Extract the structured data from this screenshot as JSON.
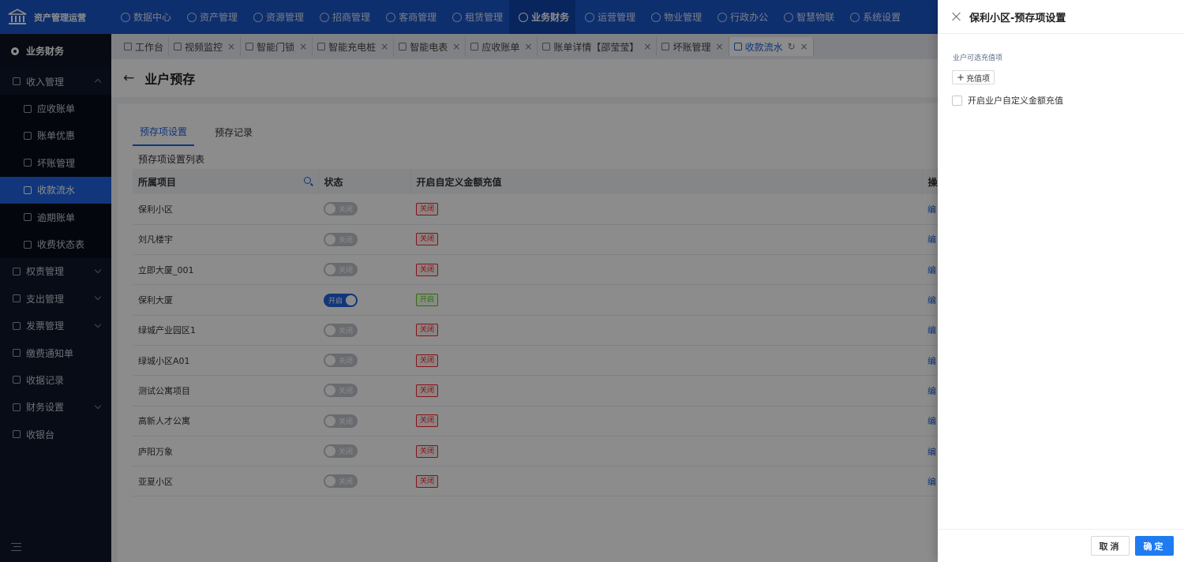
{
  "app": {
    "name": "资产管理运营"
  },
  "topnav": [
    {
      "label": "数据中心",
      "icon": "dashboard-icon"
    },
    {
      "label": "资产管理",
      "icon": "cube-icon"
    },
    {
      "label": "资源管理",
      "icon": "building-icon"
    },
    {
      "label": "招商管理",
      "icon": "tag-icon"
    },
    {
      "label": "客商管理",
      "icon": "people-icon"
    },
    {
      "label": "租赁管理",
      "icon": "house-icon"
    },
    {
      "label": "业务财务",
      "icon": "finance-icon",
      "active": true
    },
    {
      "label": "运营管理",
      "icon": "grid-icon"
    },
    {
      "label": "物业管理",
      "icon": "home-icon"
    },
    {
      "label": "行政办公",
      "icon": "monitor-icon"
    },
    {
      "label": "智慧物联",
      "icon": "iot-icon"
    },
    {
      "label": "系统设置",
      "icon": "settings-icon"
    }
  ],
  "sidebar": {
    "header": "业务财务",
    "items": [
      {
        "label": "收入管理",
        "level": 0,
        "caret": "up"
      },
      {
        "label": "应收账单",
        "level": 1
      },
      {
        "label": "账单优惠",
        "level": 1
      },
      {
        "label": "坏账管理",
        "level": 1
      },
      {
        "label": "收款流水",
        "level": 1,
        "active": true
      },
      {
        "label": "逾期账单",
        "level": 1
      },
      {
        "label": "收费状态表",
        "level": 1
      },
      {
        "label": "权责管理",
        "level": 0,
        "caret": "down"
      },
      {
        "label": "支出管理",
        "level": 0,
        "caret": "down"
      },
      {
        "label": "发票管理",
        "level": 0,
        "caret": "down"
      },
      {
        "label": "缴费通知单",
        "level": 0
      },
      {
        "label": "收据记录",
        "level": 0
      },
      {
        "label": "财务设置",
        "level": 0,
        "caret": "down"
      },
      {
        "label": "收银台",
        "level": 0
      }
    ]
  },
  "tabs": [
    {
      "label": "工作台",
      "closable": false
    },
    {
      "label": "视频监控",
      "closable": true
    },
    {
      "label": "智能门锁",
      "closable": true
    },
    {
      "label": "智能充电桩",
      "closable": true
    },
    {
      "label": "智能电表",
      "closable": true
    },
    {
      "label": "应收账单",
      "closable": true
    },
    {
      "label": "账单详情【邵莹莹】",
      "closable": true
    },
    {
      "label": "坏账管理",
      "closable": true
    },
    {
      "label": "收款流水",
      "closable": true,
      "active": true
    }
  ],
  "page": {
    "title": "业户预存"
  },
  "content_tabs": [
    {
      "label": "预存项设置",
      "active": true
    },
    {
      "label": "预存记录"
    }
  ],
  "list": {
    "title": "预存项设置列表",
    "columns": [
      "所属项目",
      "状态",
      "开启自定义金额充值",
      "操"
    ],
    "rows": [
      {
        "project": "保利小区",
        "status": "关闭",
        "on": false,
        "custom": "关闭",
        "op": "编"
      },
      {
        "project": "刘凡楼宇",
        "status": "关闭",
        "on": false,
        "custom": "关闭",
        "op": "编"
      },
      {
        "project": "立即大厦_001",
        "status": "关闭",
        "on": false,
        "custom": "关闭",
        "op": "编"
      },
      {
        "project": "保利大厦",
        "status": "开启",
        "on": true,
        "custom": "开启",
        "op": "编"
      },
      {
        "project": "绿城产业园区1",
        "status": "关闭",
        "on": false,
        "custom": "关闭",
        "op": "编"
      },
      {
        "project": "绿城小区A01",
        "status": "关闭",
        "on": false,
        "custom": "关闭",
        "op": "编"
      },
      {
        "project": "测试公寓项目",
        "status": "关闭",
        "on": false,
        "custom": "关闭",
        "op": "编"
      },
      {
        "project": "高新人才公寓",
        "status": "关闭",
        "on": false,
        "custom": "关闭",
        "op": "编"
      },
      {
        "project": "庐阳万象",
        "status": "关闭",
        "on": false,
        "custom": "关闭",
        "op": "编"
      },
      {
        "project": "亚夏小区",
        "status": "关闭",
        "on": false,
        "custom": "关闭",
        "op": "编"
      }
    ]
  },
  "drawer": {
    "title": "保利小区-预存项设置",
    "options_label": "业户可选充值项",
    "add_label": "充值项",
    "custom_label": "开启业户自定义金额充值",
    "cancel": "取消",
    "ok": "确定"
  },
  "colors": {
    "primary": "#1f63e0",
    "topbar": "#1a57c9",
    "sidebar": "#101729"
  }
}
